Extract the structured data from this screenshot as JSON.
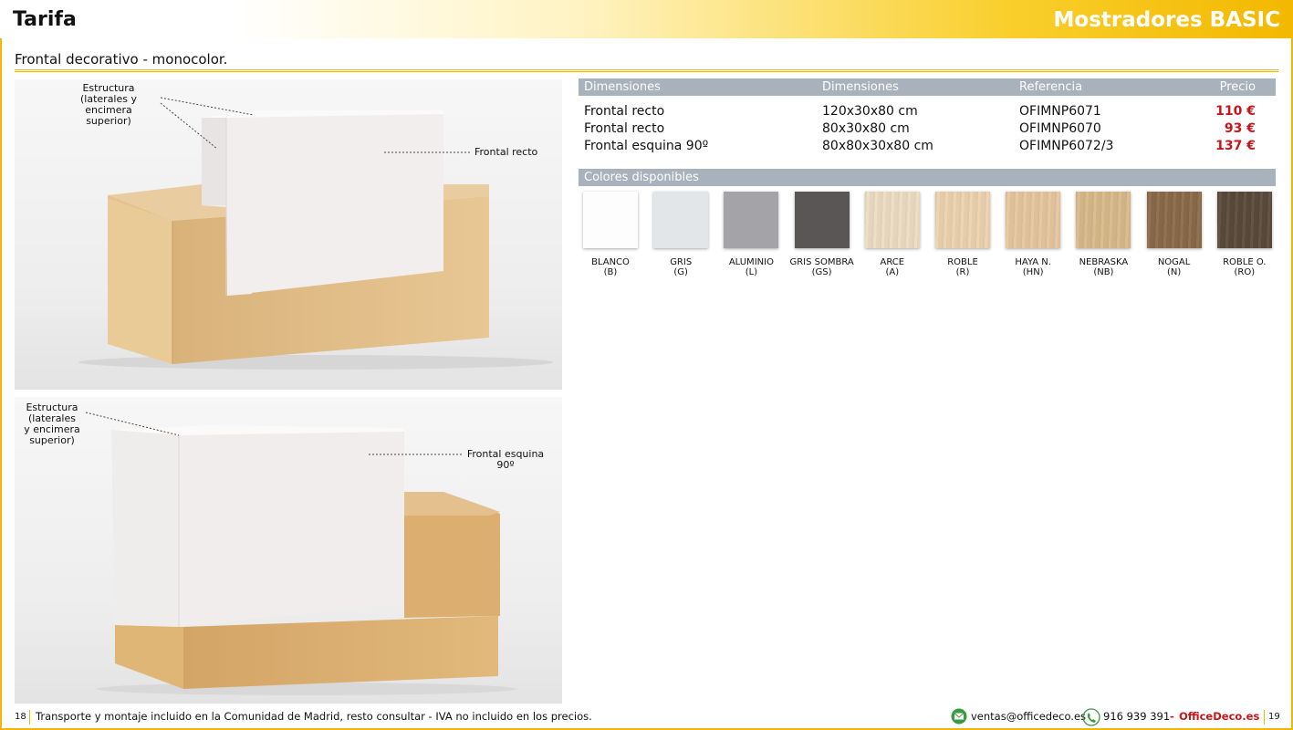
{
  "header": {
    "left_title": "Tarifa",
    "right_title": "Mostradores BASIC"
  },
  "subtitle": "Frontal decorativo - monocolor.",
  "photo1": {
    "callout_structure": [
      "Estructura",
      "(laterales y encimera",
      "superior)"
    ],
    "callout_front": "Frontal recto"
  },
  "photo2": {
    "callout_structure": [
      "Estructura",
      "(laterales",
      "y encimera",
      "superior)"
    ],
    "callout_front": [
      "Frontal esquina",
      "90º"
    ]
  },
  "table": {
    "headers": [
      "Dimensiones",
      "Dimensiones",
      "Referencia",
      "Precio"
    ],
    "rows": [
      {
        "name": "Frontal recto",
        "dims": "120x30x80 cm",
        "ref": "OFIMNP6071",
        "price": "110 €"
      },
      {
        "name": "Frontal recto",
        "dims": "80x30x80 cm",
        "ref": "OFIMNP6070",
        "price": "93 €"
      },
      {
        "name": "Frontal esquina 90º",
        "dims": "80x80x30x80 cm",
        "ref": "OFIMNP6072/3",
        "price": "137 €"
      }
    ]
  },
  "colors": {
    "title": "Colores disponibles",
    "items": [
      {
        "name": "BLANCO",
        "code": "(B)",
        "hex": "#fdfdfd"
      },
      {
        "name": "GRIS",
        "code": "(G)",
        "hex": "#e3e6e9"
      },
      {
        "name": "ALUMINIO",
        "code": "(L)",
        "hex": "#a3a3a8"
      },
      {
        "name": "GRIS SOMBRA",
        "code": "(GS)",
        "hex": "#5a5656"
      },
      {
        "name": "ARCE",
        "code": "(A)",
        "hex": "#ecdcc3"
      },
      {
        "name": "ROBLE",
        "code": "(R)",
        "hex": "#ecd2ae"
      },
      {
        "name": "HAYA N.",
        "code": "(HN)",
        "hex": "#e6c6a0"
      },
      {
        "name": "NEBRASKA",
        "code": "(NB)",
        "hex": "#d8b98a"
      },
      {
        "name": "NOGAL",
        "code": "(N)",
        "hex": "#8a6a4a"
      },
      {
        "name": "ROBLE O.",
        "code": "(RO)",
        "hex": "#5b4a3c"
      }
    ]
  },
  "footer": {
    "page_left": "18",
    "note": "Transporte y montaje incluido en la Comunidad de Madrid, resto consultar - IVA no incluido en los precios.",
    "email": "ventas@officedeco.es",
    "phone": "916 939 391",
    "dash": "-",
    "brand": "OfficeDeco.es",
    "page_right": "19"
  },
  "accent": "#f3b800",
  "price_color": "#c8151b"
}
